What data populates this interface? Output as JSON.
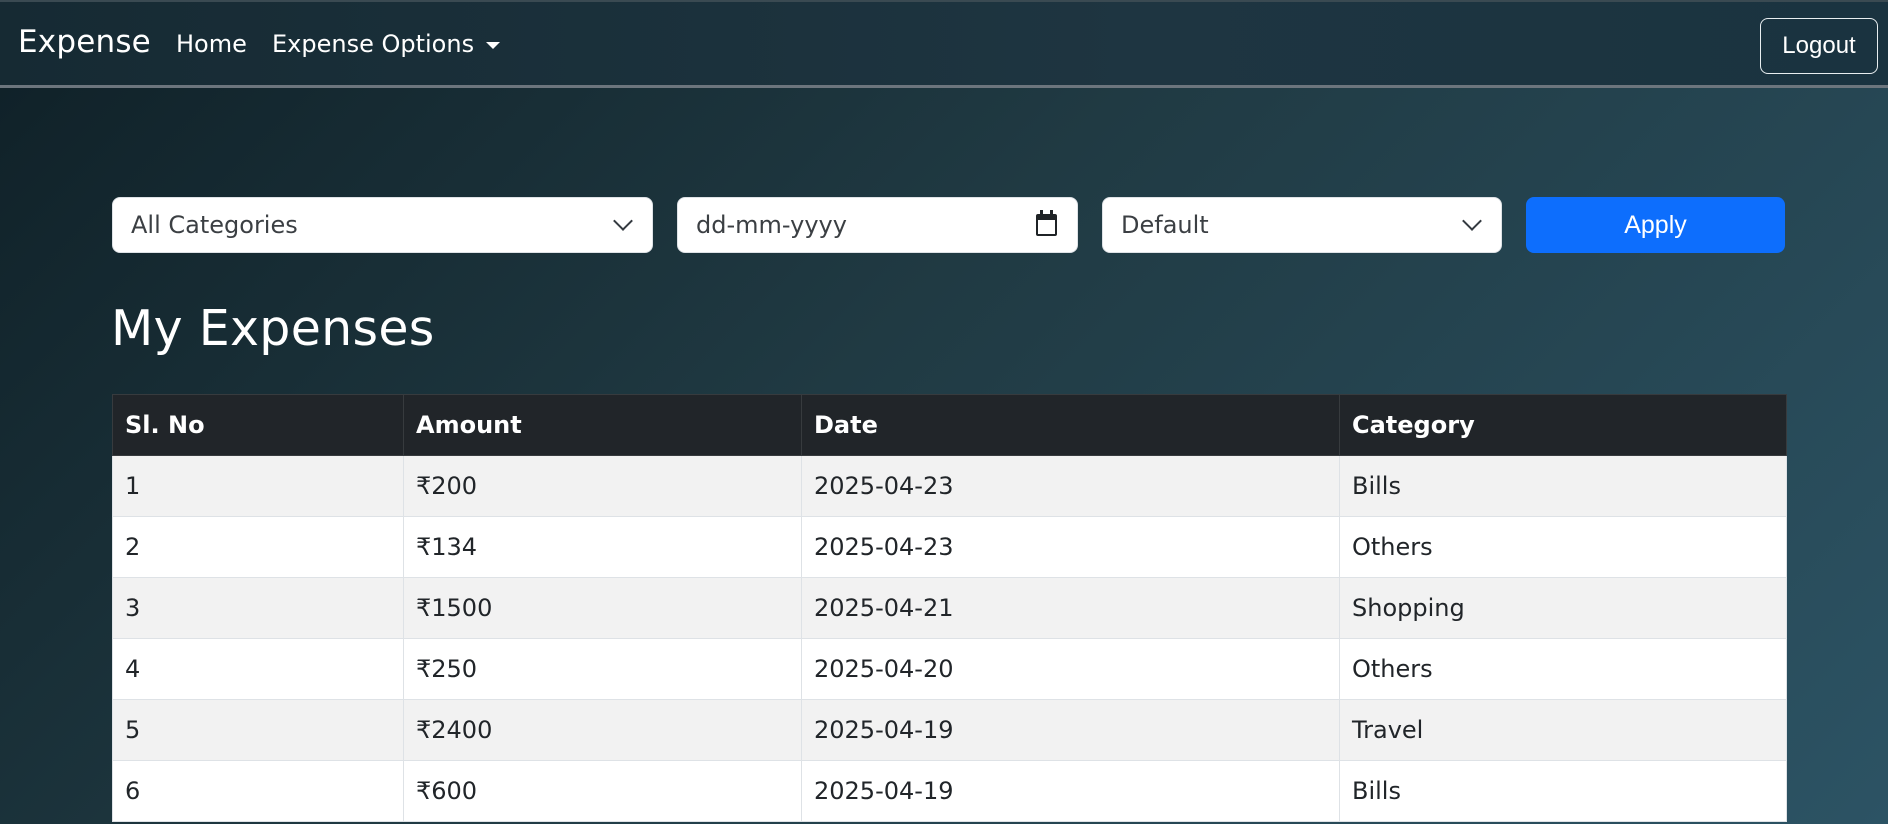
{
  "navbar": {
    "brand": "Expense",
    "links": [
      {
        "label": "Home"
      },
      {
        "label": "Expense Options"
      }
    ],
    "logout_label": "Logout"
  },
  "filters": {
    "category_value": "All Categories",
    "date_placeholder": "dd-mm-yyyy",
    "sort_value": "Default",
    "apply_label": "Apply"
  },
  "page_title": "My Expenses",
  "table": {
    "headers": [
      "Sl. No",
      "Amount",
      "Date",
      "Category"
    ],
    "rows": [
      [
        "1",
        "₹200",
        "2025-04-23",
        "Bills"
      ],
      [
        "2",
        "₹134",
        "2025-04-23",
        "Others"
      ],
      [
        "3",
        "₹1500",
        "2025-04-21",
        "Shopping"
      ],
      [
        "4",
        "₹250",
        "2025-04-20",
        "Others"
      ],
      [
        "5",
        "₹2400",
        "2025-04-19",
        "Travel"
      ],
      [
        "6",
        "₹600",
        "2025-04-19",
        "Bills"
      ]
    ]
  },
  "colors": {
    "primary_button": "#0d6efd",
    "table_header": "#212529",
    "stripe": "#f2f2f2"
  },
  "icons": [
    "chevron-down-icon",
    "calendar-icon",
    "dropdown-caret-icon"
  ]
}
